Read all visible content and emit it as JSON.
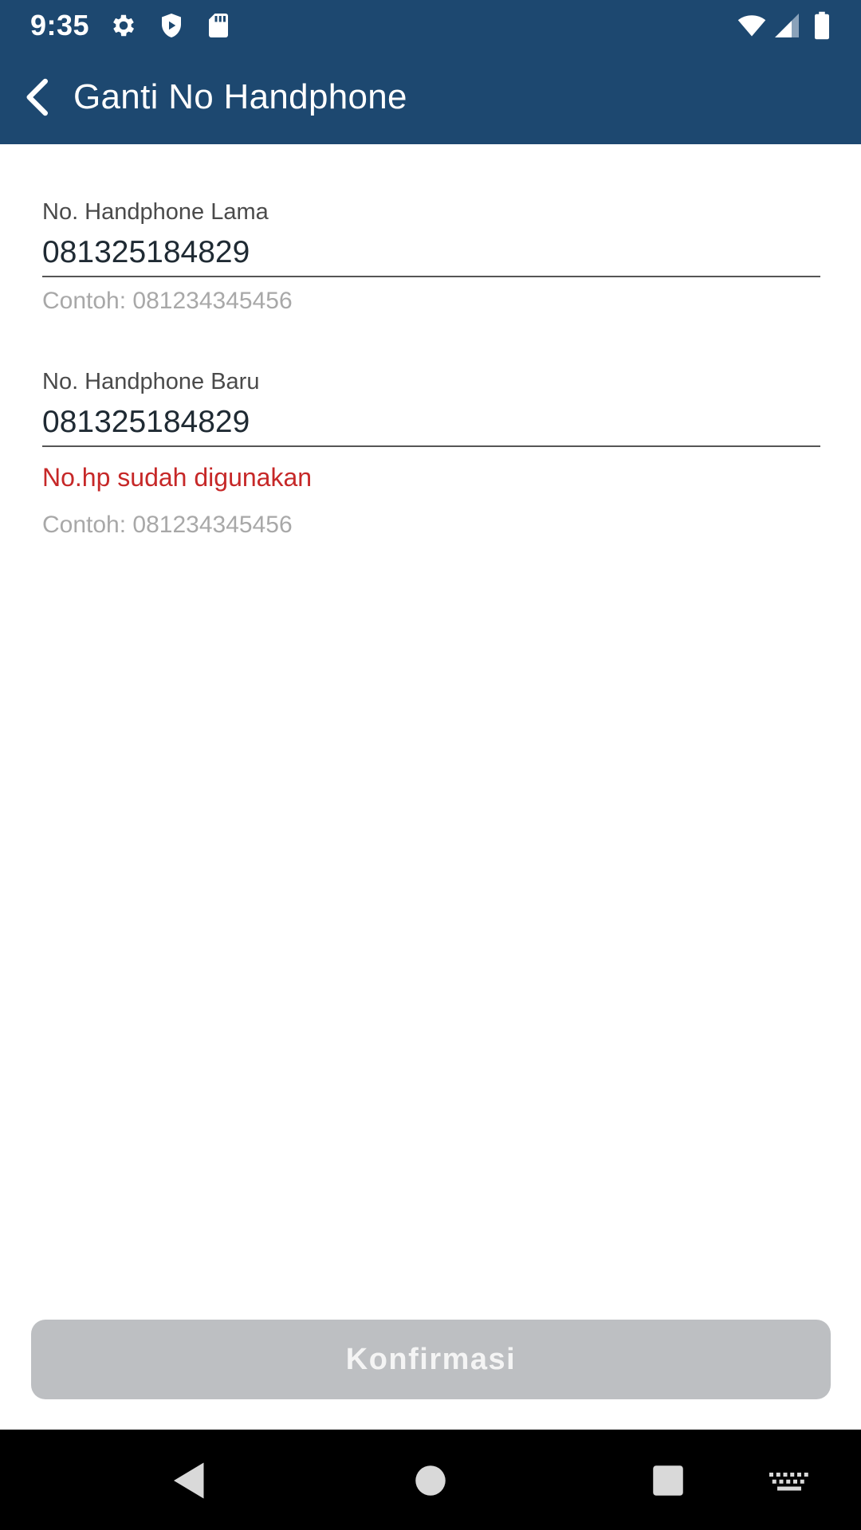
{
  "status_bar": {
    "time": "9:35",
    "icons": [
      "gear-icon",
      "shield-icon",
      "sd-card-icon",
      "wifi-icon",
      "signal-icon",
      "battery-icon"
    ]
  },
  "app_bar": {
    "title": "Ganti No Handphone",
    "back_icon": "chevron-left-icon",
    "background_color": "#1d4870"
  },
  "form": {
    "old_phone": {
      "label": "No. Handphone Lama",
      "value": "081325184829",
      "helper": "Contoh: 081234345456"
    },
    "new_phone": {
      "label": "No. Handphone Baru",
      "value": "081325184829",
      "error": "No.hp sudah digunakan",
      "helper": "Contoh: 081234345456"
    }
  },
  "confirm_button": {
    "label": "Konfirmasi",
    "state": "disabled"
  },
  "nav_bar": {
    "icons": [
      "back-triangle-icon",
      "home-circle-icon",
      "recents-square-icon",
      "keyboard-icon"
    ]
  },
  "colors": {
    "primary": "#1d4870",
    "error": "#c62828",
    "helper": "#a8a8a8",
    "disabled_button": "#bdbfc2"
  }
}
